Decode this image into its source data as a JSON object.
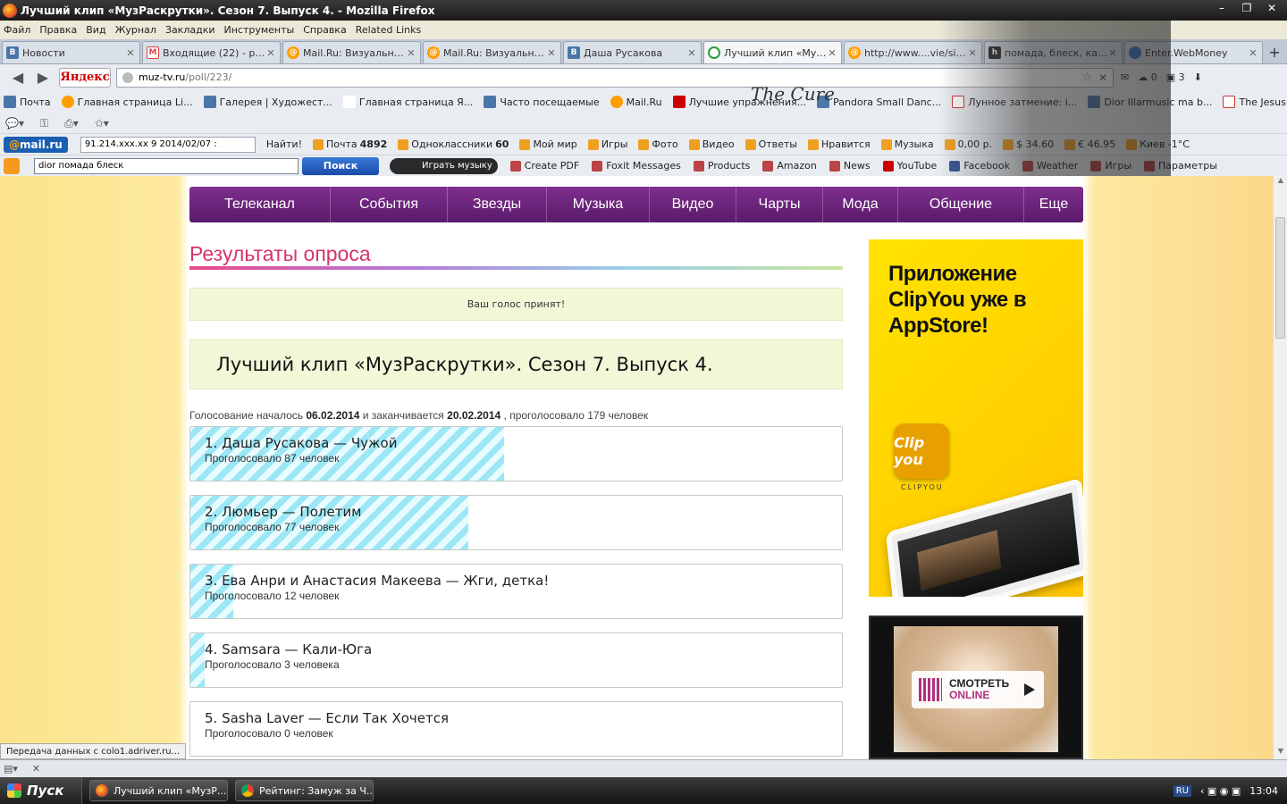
{
  "window": {
    "title": "Лучший клип «МузРаскрутки». Сезон 7. Выпуск 4. - Mozilla Firefox",
    "min": "–",
    "max": "❐",
    "close": "✕"
  },
  "menu": [
    "Файл",
    "Правка",
    "Вид",
    "Журнал",
    "Закладки",
    "Инструменты",
    "Справка",
    "Related Links"
  ],
  "tabs": [
    {
      "label": "Новости",
      "icon": "В",
      "kind": "vk",
      "active": false
    },
    {
      "label": "Входящие (22) - pink...",
      "icon": "M",
      "kind": "gmail",
      "active": false
    },
    {
      "label": "Mail.Ru: Визуальные...",
      "icon": "@",
      "kind": "mail",
      "active": false
    },
    {
      "label": "Mail.Ru: Визуальные...",
      "icon": "@",
      "kind": "mail",
      "active": false
    },
    {
      "label": "Даша Русакова",
      "icon": "В",
      "kind": "vk",
      "active": false
    },
    {
      "label": "Лучший клип «МузР...",
      "icon": "",
      "kind": "load",
      "active": true
    },
    {
      "label": "http://www....vie/site...",
      "icon": "@",
      "kind": "mail",
      "active": false
    },
    {
      "label": "помада, блеск, кар...",
      "icon": "h",
      "kind": "h",
      "active": false
    },
    {
      "label": "Enter.WebMoney",
      "icon": "",
      "kind": "wm",
      "active": false
    }
  ],
  "navbar": {
    "back": "◀",
    "forward": "▶",
    "yandex": "Яндекс",
    "url_domain": "muz-tv.ru",
    "url_path": "/poll/223/",
    "mail_count": "0",
    "msg_count": "3"
  },
  "bookmarks": [
    {
      "label": "Почта",
      "kind": "vk"
    },
    {
      "label": "Главная страница Li...",
      "kind": "mail"
    },
    {
      "label": "Галерея | Художест...",
      "kind": "vk"
    },
    {
      "label": "Главная страница Я...",
      "kind": "ya"
    },
    {
      "label": "Часто посещаемые",
      "kind": "vk"
    },
    {
      "label": "Mail.Ru",
      "kind": "mail"
    },
    {
      "label": "Лучшие упражнения...",
      "kind": "yt"
    },
    {
      "label": "Pandora Small Danc...",
      "kind": "vk"
    },
    {
      "label": "Лунное затмение: i...",
      "kind": "rs"
    },
    {
      "label": "Dior Illarmusic ma b...",
      "kind": "vk"
    },
    {
      "label": "The Jesus And Mary ...",
      "kind": "rs"
    }
  ],
  "mailbar": {
    "logo_at": "@",
    "logo_text": "mail.ru",
    "search_value": "91.214.xxx.xx 9 2014/02/07 :",
    "find": "Найти!",
    "items": [
      {
        "label": "Почта",
        "value": "4892"
      },
      {
        "label": "Одноклассники",
        "value": "60"
      },
      {
        "label": "Мой мир",
        "value": ""
      },
      {
        "label": "Игры",
        "value": ""
      },
      {
        "label": "Фото",
        "value": ""
      },
      {
        "label": "Видео",
        "value": ""
      },
      {
        "label": "Ответы",
        "value": ""
      },
      {
        "label": "Нравится",
        "value": ""
      },
      {
        "label": "Музыка",
        "value": ""
      },
      {
        "label": "0,00 р.",
        "value": ""
      },
      {
        "label": "$ 34.60",
        "value": ""
      },
      {
        "label": "€ 46.95",
        "value": ""
      },
      {
        "label": "Киев -1°C",
        "value": ""
      }
    ]
  },
  "askbar": {
    "search_value": "dior помада блеск",
    "search_btn": "Поиск",
    "play": "Играть музыку",
    "items": [
      {
        "label": "Create PDF",
        "kind": "pdf"
      },
      {
        "label": "Foxit Messages",
        "kind": "pdf"
      },
      {
        "label": "Products",
        "kind": "pdf"
      },
      {
        "label": "Amazon",
        "kind": "pdf"
      },
      {
        "label": "News",
        "kind": "pdf"
      },
      {
        "label": "YouTube",
        "kind": "yt"
      },
      {
        "label": "Facebook",
        "kind": "fb"
      },
      {
        "label": "Weather",
        "kind": "pdf"
      },
      {
        "label": "Игры",
        "kind": "pdf"
      },
      {
        "label": "Параметры",
        "kind": "pdf"
      }
    ]
  },
  "persona_text": "The Cure",
  "site": {
    "nav": [
      {
        "label": "Телеканал",
        "w": 158
      },
      {
        "label": "События",
        "w": 131
      },
      {
        "label": "Звезды",
        "w": 111
      },
      {
        "label": "Музыка",
        "w": 115
      },
      {
        "label": "Видео",
        "w": 97
      },
      {
        "label": "Чарты",
        "w": 97
      },
      {
        "label": "Мода",
        "w": 84
      },
      {
        "label": "Общение",
        "w": 141
      },
      {
        "label": "Еще",
        "w": 66
      }
    ],
    "section_title": "Результаты опроса",
    "confirm": "Ваш голос принят!",
    "poll_name": "Лучший клип «МузРаскрутки». Сезон 7. Выпуск 4.",
    "meta": {
      "started": "Голосование началось",
      "start_date": "06.02.2014",
      "ends": "и заканчивается",
      "end_date": "20.02.2014",
      "voted": ", проголосовало 179 человек"
    },
    "options": [
      {
        "label": "1. Даша Русакова — Чужой",
        "votes_text": "Проголосовало 87 человек",
        "votes": 87
      },
      {
        "label": "2. Люмьер — Полетим",
        "votes_text": "Проголосовало 77 человек",
        "votes": 77
      },
      {
        "label": "3. Ева Анри и Анастасия Макеева — Жги, детка!",
        "votes_text": "Проголосовало 12 человек",
        "votes": 12
      },
      {
        "label": "4. Samsara — Кали-Юга",
        "votes_text": "Проголосовало 3 человека",
        "votes": 3
      },
      {
        "label": "5. Sasha Laver — Если Так Хочется",
        "votes_text": "Проголосовало 0 человек",
        "votes": 0
      }
    ],
    "ad1": {
      "headline": "Приложение ClipYou уже в AppStore!",
      "app_icon": "Clip you",
      "app_name": "CLIPYOU"
    },
    "ad2": {
      "line1": "СМОТРЕТЬ",
      "line2": "ONLINE",
      "brand": "МУЗ"
    }
  },
  "status_tip": "Передача данных с colo1.adriver.ru...",
  "taskbar": {
    "start": "Пуск",
    "items": [
      {
        "label": "Лучший клип «МузР...",
        "kind": "ff"
      },
      {
        "label": "Рейтинг: Замуж за Ч...",
        "kind": "chrome"
      }
    ],
    "lang": "RU",
    "time": "13:04"
  },
  "colors": {
    "nav_purple": "#6a2278",
    "title_pink": "#d6336c",
    "stripe": "#9be7f5"
  }
}
